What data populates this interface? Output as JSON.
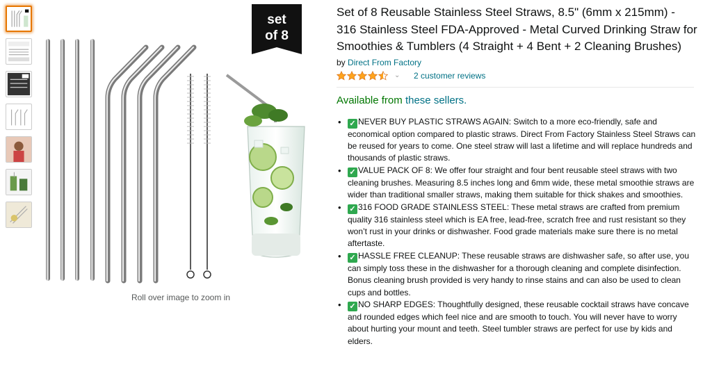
{
  "product": {
    "title": "Set of 8 Reusable Stainless Steel Straws, 8.5\" (6mm x 215mm) - 316 Stainless Steel FDA-Approved - Metal Curved Drinking Straw for Smoothies & Tumblers (4 Straight + 4 Bent + 2 Cleaning Brushes)",
    "by_prefix": "by",
    "brand": "Direct From Factory",
    "rating": 4.5,
    "reviews_label": "2 customer reviews",
    "availability_prefix": "Available from",
    "availability_link": "these sellers."
  },
  "gallery": {
    "badge_line1": "set",
    "badge_line2": "of 8",
    "zoom_hint": "Roll over image to zoom in",
    "thumbnail_count": 7
  },
  "bullets": [
    {
      "check": "✓",
      "text": "NEVER BUY PLASTIC STRAWS AGAIN: Switch to a more eco-friendly, safe and economical option compared to plastic straws. Direct From Factory Stainless Steel Straws can be reused for years to come. One steel straw will last a lifetime and will replace hundreds and thousands of plastic straws."
    },
    {
      "check": "✓",
      "text": "VALUE PACK OF 8: We offer four straight and four bent reusable steel straws with two cleaning brushes. Measuring 8.5 inches long and 6mm wide, these metal smoothie straws are wider than traditional smaller straws, making them suitable for thick shakes and smoothies."
    },
    {
      "check": "✓",
      "text": "316 FOOD GRADE STAINLESS STEEL: These metal straws are crafted from premium quality 316 stainless steel which is EA free, lead-free, scratch free and rust resistant so they won’t rust in your drinks or dishwasher. Food grade materials make sure there is no metal aftertaste."
    },
    {
      "check": "✓",
      "text": "HASSLE FREE CLEANUP: These reusable straws are dishwasher safe, so after use, you can simply toss these in the dishwasher for a thorough cleaning and complete disinfection. Bonus cleaning brush provided is very handy to rinse stains and can also be used to clean cups and bottles."
    },
    {
      "check": "✓",
      "text": "NO SHARP EDGES: Thoughtfully designed, these reusable cocktail straws have concave and rounded edges which feel nice and are smooth to touch. You will never have to worry about hurting your mount and teeth. Steel tumbler straws are perfect for use by kids and elders."
    }
  ],
  "colors": {
    "link": "#007185",
    "availability": "#007600",
    "star": "#ffa41c",
    "check": "#2fa84f",
    "thumb_active": "#e77600"
  }
}
